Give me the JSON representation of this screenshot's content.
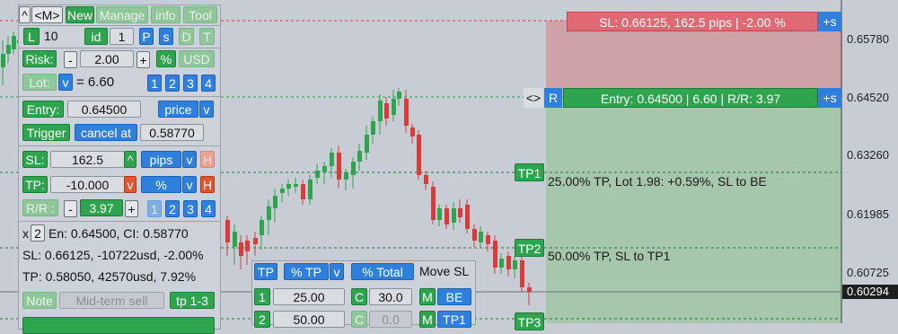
{
  "colors": {
    "bull": "#2ea44f",
    "bear": "#d93a3a",
    "sl_zone": "#cfa2a8",
    "tp_zone": "#9fc3a5",
    "entry_line": "#2ea44f",
    "sl_line": "#d93a3a",
    "tp_line": "#1f8a3a"
  },
  "axis": {
    "prices": [
      "0.65780",
      "0.64520",
      "0.63260",
      "0.61985",
      "0.60725"
    ],
    "current": "0.60294"
  },
  "candles": [
    {
      "o": 0.6545,
      "h": 0.657,
      "l": 0.652,
      "c": 0.656
    },
    {
      "o": 0.656,
      "h": 0.6578,
      "l": 0.655,
      "c": 0.6575
    },
    {
      "o": 0.6575,
      "h": 0.659,
      "l": 0.6568,
      "c": 0.6585
    },
    {
      "o": 0.6585,
      "h": 0.6595,
      "l": 0.654,
      "c": 0.6548
    },
    {
      "o": 0.6548,
      "h": 0.6558,
      "l": 0.652,
      "c": 0.653
    }
  ],
  "panel": {
    "top_row": {
      "caret": "^",
      "m": "<M>",
      "new": "New",
      "manage": "Manage",
      "info": "info",
      "tool": "Tool"
    },
    "lots_row": {
      "l": "L",
      "lots": "10",
      "id": "id",
      "id_val": "1",
      "p": "P",
      "s": "s",
      "d": "D",
      "t": "T"
    },
    "risk_row": {
      "label": "Risk:",
      "minus": "-",
      "value": "2.00",
      "plus": "+",
      "pct": "%",
      "usd": "USD"
    },
    "lot_row": {
      "label": "Lot:",
      "v": "v",
      "value": "= 6.60",
      "n1": "1",
      "n2": "2",
      "n3": "3",
      "n4": "4"
    },
    "entry_row": {
      "label": "Entry:",
      "value": "0.64500",
      "price": "price",
      "v": "v"
    },
    "trigger_row": {
      "label": "Trigger",
      "cancel": "cancel at",
      "value": "0.58770"
    },
    "sl_row": {
      "label": "SL:",
      "value": "162.5",
      "caret": "^",
      "pips": "pips",
      "v": "v",
      "h": "H"
    },
    "tp_row": {
      "label": "TP:",
      "value": "-10.000",
      "v": "v",
      "pct": "%",
      "v2": "v",
      "h": "H"
    },
    "rr_row": {
      "label": "R/R :",
      "minus": "-",
      "value": "3.97",
      "plus": "+",
      "n1": "1",
      "n2": "2",
      "n3": "3",
      "n4": "4"
    },
    "info": {
      "x": "x",
      "x_val": "2",
      "line1": "En: 0.64500, CI: 0.58770",
      "line2": "SL: 0.66125, -10722usd, -2.00%",
      "line3": "TP: 0.58050, 42570usd, 7.92%"
    },
    "note_row": {
      "note": "Note",
      "text": "Mid-term sell",
      "tp": "tp 1-3"
    }
  },
  "levels": {
    "sl_label": "SL: 0.66125, 162.5 pips | -2.00 %",
    "sl_plus": "+s",
    "entry_arrows": "<>",
    "entry_r": "R",
    "entry_label": "Entry: 0.64500 | 6.60 | R/R: 3.97",
    "entry_plus": "+s",
    "tp1": "TP1",
    "tp1_text": "25.00% TP, Lot 1.98: +0.59%, SL to BE",
    "tp2": "TP2",
    "tp2_text": "50.00% TP, SL to TP1",
    "tp3": "TP3"
  },
  "partial": {
    "tp": "TP",
    "pct_tp": "% TP",
    "v": "v",
    "pct_total": "% Total",
    "move_sl": "Move SL",
    "rows": [
      {
        "n": "1",
        "pct": "25.00",
        "c": "C",
        "cval": "30.0",
        "m": "M",
        "move": "BE"
      },
      {
        "n": "2",
        "pct": "50.00",
        "c": "C",
        "cval": "0.0",
        "m": "M",
        "move": "TP1"
      }
    ]
  }
}
